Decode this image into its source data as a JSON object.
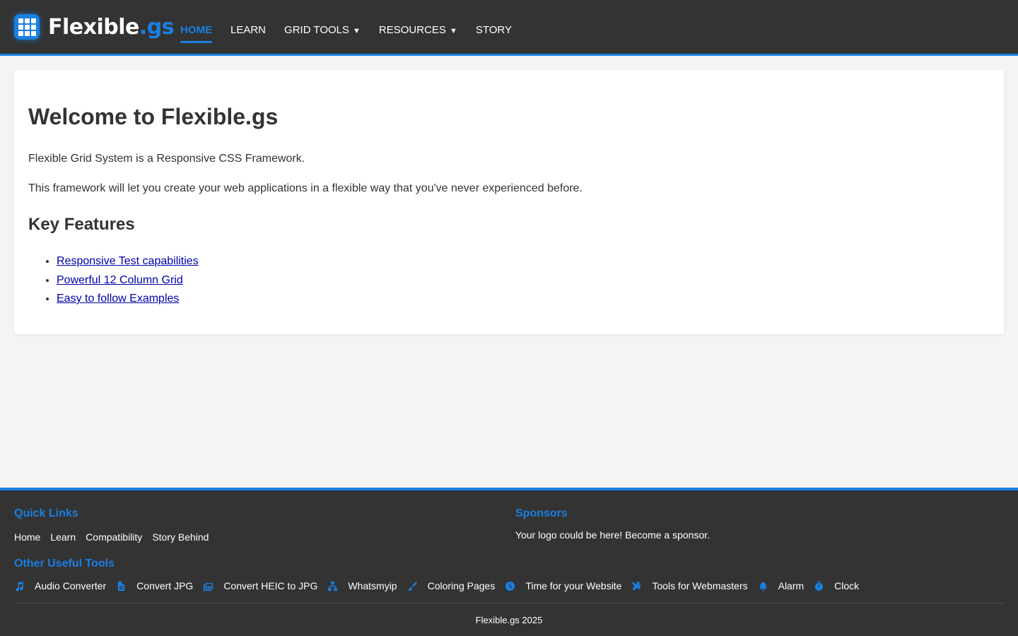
{
  "header": {
    "logo_main": "Flexible",
    "logo_accent": ".gs",
    "nav": [
      {
        "label": "HOME",
        "active": true
      },
      {
        "label": "LEARN"
      },
      {
        "label": "GRID TOOLS",
        "caret": "▼"
      },
      {
        "label": "RESOURCES",
        "caret": "▼"
      },
      {
        "label": "STORY"
      }
    ]
  },
  "main": {
    "title": "Welcome to Flexible.gs",
    "intro": "Flexible Grid System is a Responsive CSS Framework.",
    "description": "This framework will let you create your web applications in a flexible way that you've never experienced before.",
    "features_heading": "Key Features",
    "features": [
      "Responsive Test capabilities",
      "Powerful 12 Column Grid",
      "Easy to follow Examples"
    ]
  },
  "footer": {
    "quick_links_heading": "Quick Links",
    "quick_links": [
      "Home",
      "Learn",
      "Compatibility",
      "Story Behind"
    ],
    "sponsors_heading": "Sponsors",
    "sponsors_text": "Your logo could be here! Become a sponsor.",
    "tools_heading": "Other Useful Tools",
    "tools": [
      {
        "label": "Audio Converter",
        "icon": "music-icon"
      },
      {
        "label": "Convert JPG",
        "icon": "file-image-icon"
      },
      {
        "label": "Convert HEIC to JPG",
        "icon": "images-icon"
      },
      {
        "label": "Whatsmyip",
        "icon": "network-icon"
      },
      {
        "label": "Coloring Pages",
        "icon": "paintbrush-icon"
      },
      {
        "label": "Time for your Website",
        "icon": "clock-icon"
      },
      {
        "label": "Tools for Webmasters",
        "icon": "tools-icon"
      },
      {
        "label": "Alarm",
        "icon": "bell-icon"
      },
      {
        "label": "Clock",
        "icon": "stopwatch-icon"
      }
    ],
    "copyright": "Flexible.gs 2025"
  },
  "colors": {
    "accent": "#1a7fe0",
    "header_bg": "#333333",
    "page_bg": "#f4f4f4",
    "link": "#0000aa"
  }
}
